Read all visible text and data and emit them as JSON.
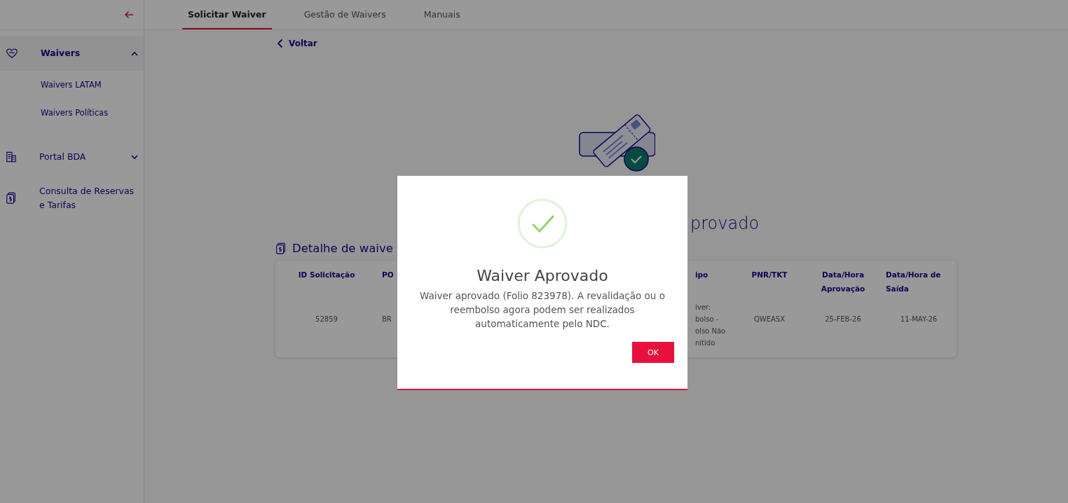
{
  "topbar": {
    "tabs": [
      {
        "label": "Solicitar Waiver",
        "selected": true
      },
      {
        "label": "Gestão de Waivers",
        "selected": false
      },
      {
        "label": "Manuais",
        "selected": false
      }
    ]
  },
  "sidebar": {
    "items": [
      {
        "label": "Waivers",
        "expanded": true,
        "children": [
          {
            "label": "Waivers LATAM"
          },
          {
            "label": "Waivers Políticas"
          }
        ]
      },
      {
        "label": "Portal BDA",
        "expanded": false
      },
      {
        "label": "Consulta de Reservas e Tarifas"
      }
    ]
  },
  "main": {
    "back_link": "Voltar",
    "heading_fragment": "provado",
    "detail_title": "Detalhe de waive",
    "table": {
      "columns": [
        "ID Solicitação",
        "PO",
        "",
        "ipo",
        "PNR/TKT",
        "Data/Hora Aprovação",
        "Data/Hora de Saída"
      ],
      "rows": [
        [
          "52859",
          "BR",
          "",
          "iver:\nbolso -\nolso Não\nnitido",
          "QWEASX",
          "25-FEB-26",
          "11-MAY-26"
        ]
      ]
    }
  },
  "dialog": {
    "title": "Waiver Aprovado",
    "message": "Waiver aprovado (Folio 823978). A revalidação ou o reembolso agora podem ser realizados automaticamente pelo NDC.",
    "button": "OK"
  }
}
